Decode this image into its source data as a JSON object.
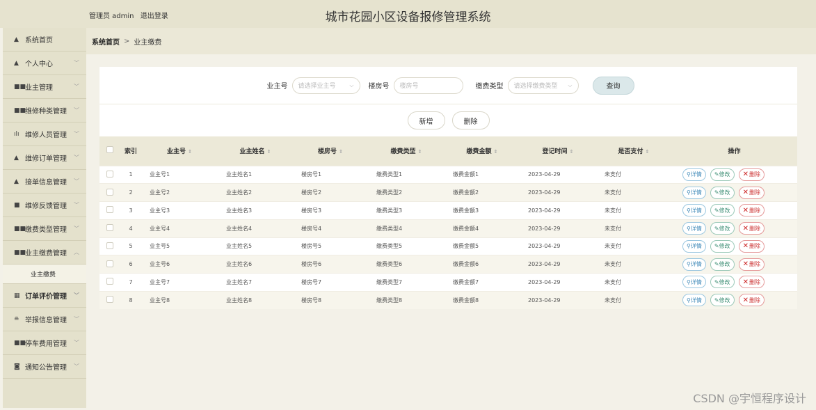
{
  "header": {
    "admin_text": "管理员 admin",
    "logout": "退出登录",
    "title": "城市花园小区设备报修管理系统"
  },
  "sidebar": {
    "items": [
      {
        "label": "系统首页",
        "icon": "home-icon",
        "glyph": "▲"
      },
      {
        "label": "个人中心",
        "icon": "user-icon",
        "glyph": "▲"
      },
      {
        "label": "业主管理",
        "icon": "grid-icon",
        "glyph": "■■"
      },
      {
        "label": "维修种类管理",
        "icon": "grid-icon",
        "glyph": "■■"
      },
      {
        "label": "维修人员管理",
        "icon": "bar-chart-icon",
        "glyph": "ılı"
      },
      {
        "label": "维修订单管理",
        "icon": "user-icon",
        "glyph": "▲"
      },
      {
        "label": "接单信息管理",
        "icon": "user-icon",
        "glyph": "▲"
      },
      {
        "label": "维修反馈管理",
        "icon": "card-icon",
        "glyph": "■"
      },
      {
        "label": "缴费类型管理",
        "icon": "grid-icon",
        "glyph": "■■"
      },
      {
        "label": "业主缴费管理",
        "icon": "grid-icon",
        "glyph": "■■"
      },
      {
        "label": "订单评价管理",
        "icon": "table-icon",
        "glyph": "▦"
      },
      {
        "label": "举报信息管理",
        "icon": "stack-icon",
        "glyph": "≘"
      },
      {
        "label": "停车费用管理",
        "icon": "grid-icon",
        "glyph": "■■"
      },
      {
        "label": "通知公告管理",
        "icon": "doc-icon",
        "glyph": "◙"
      }
    ],
    "sub_item": "业主缴费"
  },
  "breadcrumb": {
    "home": "系统首页",
    "sep": ">",
    "current": "业主缴费"
  },
  "search": {
    "owner_label": "业主号",
    "owner_placeholder": "请选择业主号",
    "room_label": "楼房号",
    "room_placeholder": "楼房号",
    "type_label": "缴费类型",
    "type_placeholder": "请选择缴费类型",
    "query": "查询"
  },
  "actions": {
    "add": "新增",
    "delete": "删除"
  },
  "table": {
    "headers": [
      "索引",
      "业主号",
      "业主姓名",
      "楼房号",
      "缴费类型",
      "缴费金额",
      "登记时间",
      "是否支付",
      "操作"
    ],
    "sort_glyph": "⇕",
    "rows": [
      [
        "1",
        "业主号1",
        "业主姓名1",
        "楼房号1",
        "缴费类型1",
        "缴费金额1",
        "2023-04-29",
        "未支付"
      ],
      [
        "2",
        "业主号2",
        "业主姓名2",
        "楼房号2",
        "缴费类型2",
        "缴费金额2",
        "2023-04-29",
        "未支付"
      ],
      [
        "3",
        "业主号3",
        "业主姓名3",
        "楼房号3",
        "缴费类型3",
        "缴费金额3",
        "2023-04-29",
        "未支付"
      ],
      [
        "4",
        "业主号4",
        "业主姓名4",
        "楼房号4",
        "缴费类型4",
        "缴费金额4",
        "2023-04-29",
        "未支付"
      ],
      [
        "5",
        "业主号5",
        "业主姓名5",
        "楼房号5",
        "缴费类型5",
        "缴费金额5",
        "2023-04-29",
        "未支付"
      ],
      [
        "6",
        "业主号6",
        "业主姓名6",
        "楼房号6",
        "缴费类型6",
        "缴费金额6",
        "2023-04-29",
        "未支付"
      ],
      [
        "7",
        "业主号7",
        "业主姓名7",
        "楼房号7",
        "缴费类型7",
        "缴费金额7",
        "2023-04-29",
        "未支付"
      ],
      [
        "8",
        "业主号8",
        "业主姓名8",
        "楼房号8",
        "缴费类型8",
        "缴费金额8",
        "2023-04-29",
        "未支付"
      ]
    ],
    "ops": {
      "view": "详情",
      "edit": "修改",
      "delete": "删除"
    }
  },
  "watermark": "CSDN @宇恒程序设计"
}
